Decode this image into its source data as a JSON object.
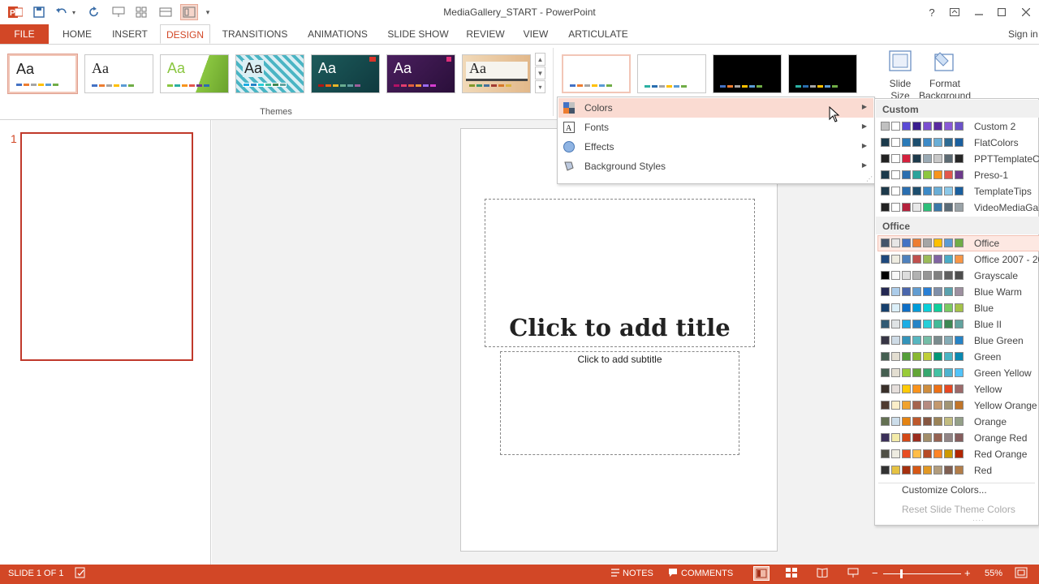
{
  "window": {
    "title": "MediaGallery_START - PowerPoint",
    "sign_in": "Sign in"
  },
  "colors": {
    "accent": "#d24726",
    "highlight": "#fadbd2"
  },
  "tabs": [
    {
      "label": "FILE"
    },
    {
      "label": "HOME"
    },
    {
      "label": "INSERT"
    },
    {
      "label": "DESIGN"
    },
    {
      "label": "TRANSITIONS"
    },
    {
      "label": "ANIMATIONS"
    },
    {
      "label": "SLIDE SHOW"
    },
    {
      "label": "REVIEW"
    },
    {
      "label": "VIEW"
    },
    {
      "label": "ARTICULATE"
    }
  ],
  "ribbon": {
    "group_label": "Themes",
    "theme_sample": "Aa",
    "slide_size": "Slide Size",
    "format_background": "Format Background"
  },
  "thumbnails": [
    {
      "number": "1"
    }
  ],
  "slide": {
    "title_placeholder": "Click to add title",
    "subtitle_placeholder": "Click to add subtitle"
  },
  "menu": {
    "items": [
      {
        "label": "Colors",
        "icon": "colors-icon"
      },
      {
        "label": "Fonts",
        "icon": "fonts-icon"
      },
      {
        "label": "Effects",
        "icon": "effects-icon"
      },
      {
        "label": "Background Styles",
        "icon": "background-styles-icon"
      }
    ]
  },
  "submenu": {
    "custom_header": "Custom",
    "custom": [
      {
        "name": "Custom 2",
        "sw": [
          "#c0c0c0",
          "#ffffff",
          "#5b4bd6",
          "#3a1e8e",
          "#7b4fd0",
          "#5a2aa0",
          "#8a5ad6",
          "#6b52c8"
        ]
      },
      {
        "name": "FlatColors",
        "sw": [
          "#1b3a4b",
          "#ffffff",
          "#2a7ab8",
          "#1d4e6e",
          "#3d8ac7",
          "#6aaed6",
          "#2d6a92",
          "#1a5f9e"
        ]
      },
      {
        "name": "PPTTemplateCo",
        "sw": [
          "#222222",
          "#ffffff",
          "#d4213d",
          "#1d3a4b",
          "#9aaab4",
          "#c8c8c8",
          "#5c6a72",
          "#262626"
        ]
      },
      {
        "name": "Preso-1",
        "sw": [
          "#1d3a4b",
          "#ffffff",
          "#2a6eb0",
          "#2ba39a",
          "#8dc63f",
          "#f7941d",
          "#e2574c",
          "#6d3a8c"
        ]
      },
      {
        "name": "TemplateTips",
        "sw": [
          "#1d3a4b",
          "#ffffff",
          "#2a6eb0",
          "#1d4e6e",
          "#3d8ac7",
          "#6aaed6",
          "#8cc8e8",
          "#1a5f9e"
        ]
      },
      {
        "name": "VideoMediaGal",
        "sw": [
          "#222222",
          "#ffffff",
          "#b5223d",
          "#e8e8e8",
          "#2dbf7a",
          "#3a78a8",
          "#5b6b77",
          "#9aa3a8"
        ]
      }
    ],
    "office_header": "Office",
    "office": [
      {
        "name": "Office",
        "sw": [
          "#44546a",
          "#e7e6e6",
          "#4472c4",
          "#ed7d31",
          "#a5a5a5",
          "#ffc000",
          "#5b9bd5",
          "#70ad47"
        ]
      },
      {
        "name": "Office 2007 - 20",
        "sw": [
          "#1f497d",
          "#eeece1",
          "#4f81bd",
          "#c0504d",
          "#9bbb59",
          "#8064a2",
          "#4bacc6",
          "#f79646"
        ]
      },
      {
        "name": "Grayscale",
        "sw": [
          "#000000",
          "#f8f8f8",
          "#dddddd",
          "#b2b2b2",
          "#969696",
          "#808080",
          "#5f5f5f",
          "#4d4d4d"
        ]
      },
      {
        "name": "Blue Warm",
        "sw": [
          "#242852",
          "#acccea",
          "#4a66ac",
          "#629dd1",
          "#297fd5",
          "#7f8fa9",
          "#5aa2ae",
          "#9d90a0"
        ]
      },
      {
        "name": "Blue",
        "sw": [
          "#17406d",
          "#dbeff9",
          "#0f6fc6",
          "#009dd9",
          "#0bd0d9",
          "#10cf9b",
          "#7cca62",
          "#a5c249"
        ]
      },
      {
        "name": "Blue II",
        "sw": [
          "#335b74",
          "#dfe3e5",
          "#1cade4",
          "#2683c6",
          "#27ced7",
          "#42ba97",
          "#3e8853",
          "#62a39f"
        ]
      },
      {
        "name": "Blue Green",
        "sw": [
          "#373545",
          "#cedbe6",
          "#3494ba",
          "#58b6c0",
          "#75bda7",
          "#7a8c8e",
          "#84acb6",
          "#2683c6"
        ]
      },
      {
        "name": "Green",
        "sw": [
          "#455f51",
          "#e3ded1",
          "#549e39",
          "#8ab833",
          "#c0cf3a",
          "#029676",
          "#4ab5c4",
          "#0989b1"
        ]
      },
      {
        "name": "Green Yellow",
        "sw": [
          "#455f51",
          "#e3ded1",
          "#99cb38",
          "#63a537",
          "#37a76f",
          "#44c1a3",
          "#4eb3cf",
          "#51c3f9"
        ]
      },
      {
        "name": "Yellow",
        "sw": [
          "#39302a",
          "#e5dedb",
          "#ffca08",
          "#f8931d",
          "#ce8d3e",
          "#ec7016",
          "#e64823",
          "#9c6a6a"
        ]
      },
      {
        "name": "Yellow Orange",
        "sw": [
          "#4e3b30",
          "#fbeec9",
          "#f0a22e",
          "#a5644e",
          "#b58b80",
          "#c3986d",
          "#a19574",
          "#c17529"
        ]
      },
      {
        "name": "Orange",
        "sw": [
          "#637052",
          "#ccddea",
          "#e48312",
          "#bd582c",
          "#865640",
          "#9b8357",
          "#c2bc80",
          "#94a088"
        ]
      },
      {
        "name": "Orange Red",
        "sw": [
          "#3b3059",
          "#f3eba9",
          "#d34817",
          "#9b2d1f",
          "#a28e6a",
          "#956251",
          "#918485",
          "#855d5d"
        ]
      },
      {
        "name": "Red Orange",
        "sw": [
          "#505046",
          "#eeece1",
          "#e84c22",
          "#ffbd47",
          "#b64926",
          "#ff8427",
          "#cc9900",
          "#b22600"
        ]
      },
      {
        "name": "Red",
        "sw": [
          "#323232",
          "#e5c243",
          "#a5300f",
          "#d55816",
          "#e19825",
          "#b19c7d",
          "#7f5f52",
          "#b27d49"
        ]
      }
    ],
    "customize": "Customize Colors...",
    "reset": "Reset Slide Theme Colors"
  },
  "status": {
    "slide": "SLIDE 1 OF 1",
    "notes": "NOTES",
    "comments": "COMMENTS",
    "zoom": "55%"
  }
}
